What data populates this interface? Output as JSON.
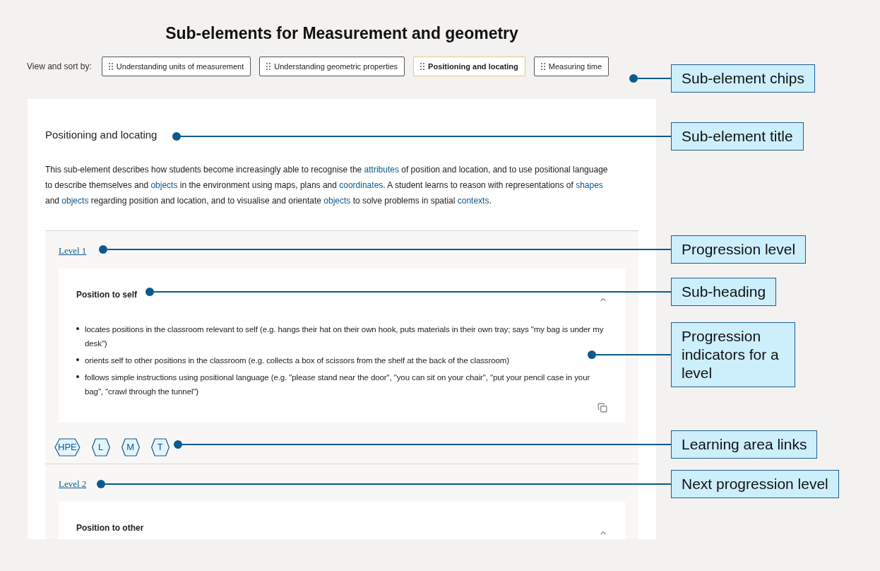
{
  "page_title": "Sub-elements for Measurement and geometry",
  "sort_label": "View and sort by:",
  "chips": [
    {
      "label": "Understanding units of measurement",
      "selected": false
    },
    {
      "label": "Understanding geometric properties",
      "selected": false
    },
    {
      "label": "Positioning and locating",
      "selected": true
    },
    {
      "label": "Measuring time",
      "selected": false
    }
  ],
  "sub_element": {
    "title": "Positioning and locating",
    "description": [
      {
        "kind": "text",
        "text": "This sub-element describes how students become increasingly able to recognise the "
      },
      {
        "kind": "link",
        "text": "attributes"
      },
      {
        "kind": "text",
        "text": " of position and location, and to use positional language to describe themselves and "
      },
      {
        "kind": "link",
        "text": "objects"
      },
      {
        "kind": "text",
        "text": " in the environment using maps, plans and "
      },
      {
        "kind": "link",
        "text": "coordinates"
      },
      {
        "kind": "text",
        "text": ". A student learns to reason with representations of "
      },
      {
        "kind": "link",
        "text": "shapes"
      },
      {
        "kind": "text",
        "text": " and "
      },
      {
        "kind": "link",
        "text": "objects"
      },
      {
        "kind": "text",
        "text": " regarding position and location, and to visualise and orientate "
      },
      {
        "kind": "link",
        "text": "objects"
      },
      {
        "kind": "text",
        "text": " to solve problems in spatial "
      },
      {
        "kind": "link",
        "text": "contexts"
      },
      {
        "kind": "text",
        "text": "."
      }
    ]
  },
  "levels": [
    {
      "label": "Level 1",
      "heading": "Position to self",
      "expanded": true,
      "indicators": [
        "locates positions in the classroom relevant to self (e.g. hangs their hat on their own hook, puts materials in their own tray; says \"my bag is under my desk\")",
        "orients self to other positions in the classroom (e.g. collects a box of scissors from the shelf at the back of the classroom)",
        "follows simple instructions using positional language (e.g. \"please stand near the door\", \"you can sit on your chair\", \"put your pencil case in your bag\", \"crawl through the tunnel\")"
      ],
      "learning_areas": [
        "HPE",
        "L",
        "M",
        "T"
      ]
    },
    {
      "label": "Level 2",
      "heading": "Position to other",
      "expanded": true
    }
  ],
  "callouts": [
    "Sub-element chips",
    "Sub-element title",
    "Progression level",
    "Sub-heading",
    "Progression indicators for a level",
    "Learning area links",
    "Next progression level"
  ]
}
